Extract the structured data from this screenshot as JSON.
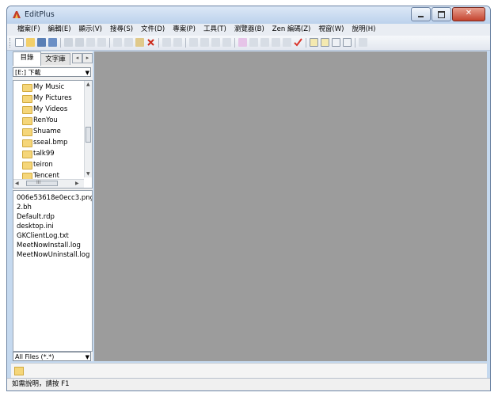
{
  "window": {
    "title": "EditPlus",
    "close_symbol": "✕"
  },
  "menu": {
    "items": [
      "檔案(F)",
      "編輯(E)",
      "顯示(V)",
      "搜尋(S)",
      "文件(D)",
      "專案(P)",
      "工具(T)",
      "瀏覽器(B)",
      "Zen 編碼(Z)",
      "視窗(W)",
      "說明(H)"
    ]
  },
  "toolbar": {
    "icons": [
      "new-file-icon",
      "open-folder-icon",
      "save-icon",
      "save-all-icon",
      "print-icon",
      "print-preview-icon",
      "spellcheck-icon",
      "cut-icon",
      "copy-icon",
      "paste-icon",
      "delete-icon",
      "undo-icon",
      "redo-icon",
      "find-icon",
      "replace-icon",
      "goto-icon",
      "font-size-icon",
      "word-wrap-icon",
      "line-number-icon",
      "ruler-icon",
      "check-icon",
      "directory-window-icon",
      "cliptext-window-icon",
      "output-window-icon",
      "help-icon"
    ]
  },
  "sidebar": {
    "tabs": [
      "目錄",
      "文字庫"
    ],
    "drive": "[E:] 下載",
    "folders": [
      "My Music",
      "My Pictures",
      "My Videos",
      "RenYou",
      "Shuame",
      "sseal.bmp",
      "talk99",
      "teiron",
      "Tencent"
    ],
    "files": [
      "006e53618e0ecc3.png",
      "2.bh",
      "Default.rdp",
      "desktop.ini",
      "GKClientLog.txt",
      "MeetNowInstall.log",
      "MeetNowUninstall.log"
    ],
    "filter": "All Files (*.*)",
    "scroll_h_label": "III"
  },
  "status": {
    "text": "如需說明，請按 F1"
  },
  "colors": {
    "editor_bg": "#9c9c9c",
    "window_frame": "#c5d9ef",
    "close_button": "#c4432e"
  }
}
